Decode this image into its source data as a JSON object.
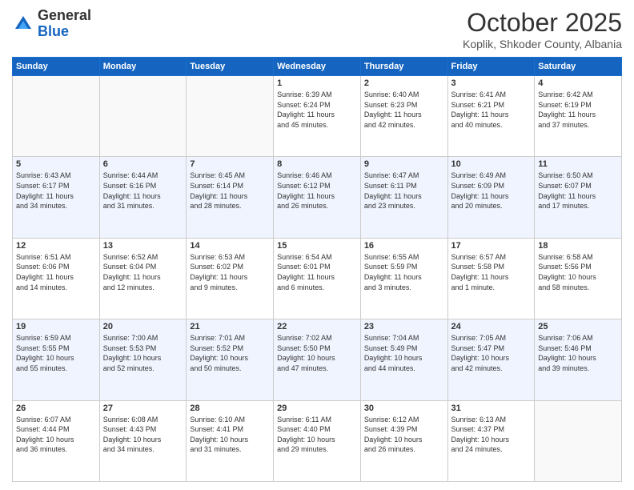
{
  "header": {
    "logo_general": "General",
    "logo_blue": "Blue",
    "month_title": "October 2025",
    "location": "Koplik, Shkoder County, Albania"
  },
  "days_of_week": [
    "Sunday",
    "Monday",
    "Tuesday",
    "Wednesday",
    "Thursday",
    "Friday",
    "Saturday"
  ],
  "weeks": [
    [
      {
        "day": "",
        "info": ""
      },
      {
        "day": "",
        "info": ""
      },
      {
        "day": "",
        "info": ""
      },
      {
        "day": "1",
        "info": "Sunrise: 6:39 AM\nSunset: 6:24 PM\nDaylight: 11 hours\nand 45 minutes."
      },
      {
        "day": "2",
        "info": "Sunrise: 6:40 AM\nSunset: 6:23 PM\nDaylight: 11 hours\nand 42 minutes."
      },
      {
        "day": "3",
        "info": "Sunrise: 6:41 AM\nSunset: 6:21 PM\nDaylight: 11 hours\nand 40 minutes."
      },
      {
        "day": "4",
        "info": "Sunrise: 6:42 AM\nSunset: 6:19 PM\nDaylight: 11 hours\nand 37 minutes."
      }
    ],
    [
      {
        "day": "5",
        "info": "Sunrise: 6:43 AM\nSunset: 6:17 PM\nDaylight: 11 hours\nand 34 minutes."
      },
      {
        "day": "6",
        "info": "Sunrise: 6:44 AM\nSunset: 6:16 PM\nDaylight: 11 hours\nand 31 minutes."
      },
      {
        "day": "7",
        "info": "Sunrise: 6:45 AM\nSunset: 6:14 PM\nDaylight: 11 hours\nand 28 minutes."
      },
      {
        "day": "8",
        "info": "Sunrise: 6:46 AM\nSunset: 6:12 PM\nDaylight: 11 hours\nand 26 minutes."
      },
      {
        "day": "9",
        "info": "Sunrise: 6:47 AM\nSunset: 6:11 PM\nDaylight: 11 hours\nand 23 minutes."
      },
      {
        "day": "10",
        "info": "Sunrise: 6:49 AM\nSunset: 6:09 PM\nDaylight: 11 hours\nand 20 minutes."
      },
      {
        "day": "11",
        "info": "Sunrise: 6:50 AM\nSunset: 6:07 PM\nDaylight: 11 hours\nand 17 minutes."
      }
    ],
    [
      {
        "day": "12",
        "info": "Sunrise: 6:51 AM\nSunset: 6:06 PM\nDaylight: 11 hours\nand 14 minutes."
      },
      {
        "day": "13",
        "info": "Sunrise: 6:52 AM\nSunset: 6:04 PM\nDaylight: 11 hours\nand 12 minutes."
      },
      {
        "day": "14",
        "info": "Sunrise: 6:53 AM\nSunset: 6:02 PM\nDaylight: 11 hours\nand 9 minutes."
      },
      {
        "day": "15",
        "info": "Sunrise: 6:54 AM\nSunset: 6:01 PM\nDaylight: 11 hours\nand 6 minutes."
      },
      {
        "day": "16",
        "info": "Sunrise: 6:55 AM\nSunset: 5:59 PM\nDaylight: 11 hours\nand 3 minutes."
      },
      {
        "day": "17",
        "info": "Sunrise: 6:57 AM\nSunset: 5:58 PM\nDaylight: 11 hours\nand 1 minute."
      },
      {
        "day": "18",
        "info": "Sunrise: 6:58 AM\nSunset: 5:56 PM\nDaylight: 10 hours\nand 58 minutes."
      }
    ],
    [
      {
        "day": "19",
        "info": "Sunrise: 6:59 AM\nSunset: 5:55 PM\nDaylight: 10 hours\nand 55 minutes."
      },
      {
        "day": "20",
        "info": "Sunrise: 7:00 AM\nSunset: 5:53 PM\nDaylight: 10 hours\nand 52 minutes."
      },
      {
        "day": "21",
        "info": "Sunrise: 7:01 AM\nSunset: 5:52 PM\nDaylight: 10 hours\nand 50 minutes."
      },
      {
        "day": "22",
        "info": "Sunrise: 7:02 AM\nSunset: 5:50 PM\nDaylight: 10 hours\nand 47 minutes."
      },
      {
        "day": "23",
        "info": "Sunrise: 7:04 AM\nSunset: 5:49 PM\nDaylight: 10 hours\nand 44 minutes."
      },
      {
        "day": "24",
        "info": "Sunrise: 7:05 AM\nSunset: 5:47 PM\nDaylight: 10 hours\nand 42 minutes."
      },
      {
        "day": "25",
        "info": "Sunrise: 7:06 AM\nSunset: 5:46 PM\nDaylight: 10 hours\nand 39 minutes."
      }
    ],
    [
      {
        "day": "26",
        "info": "Sunrise: 6:07 AM\nSunset: 4:44 PM\nDaylight: 10 hours\nand 36 minutes."
      },
      {
        "day": "27",
        "info": "Sunrise: 6:08 AM\nSunset: 4:43 PM\nDaylight: 10 hours\nand 34 minutes."
      },
      {
        "day": "28",
        "info": "Sunrise: 6:10 AM\nSunset: 4:41 PM\nDaylight: 10 hours\nand 31 minutes."
      },
      {
        "day": "29",
        "info": "Sunrise: 6:11 AM\nSunset: 4:40 PM\nDaylight: 10 hours\nand 29 minutes."
      },
      {
        "day": "30",
        "info": "Sunrise: 6:12 AM\nSunset: 4:39 PM\nDaylight: 10 hours\nand 26 minutes."
      },
      {
        "day": "31",
        "info": "Sunrise: 6:13 AM\nSunset: 4:37 PM\nDaylight: 10 hours\nand 24 minutes."
      },
      {
        "day": "",
        "info": ""
      }
    ]
  ]
}
